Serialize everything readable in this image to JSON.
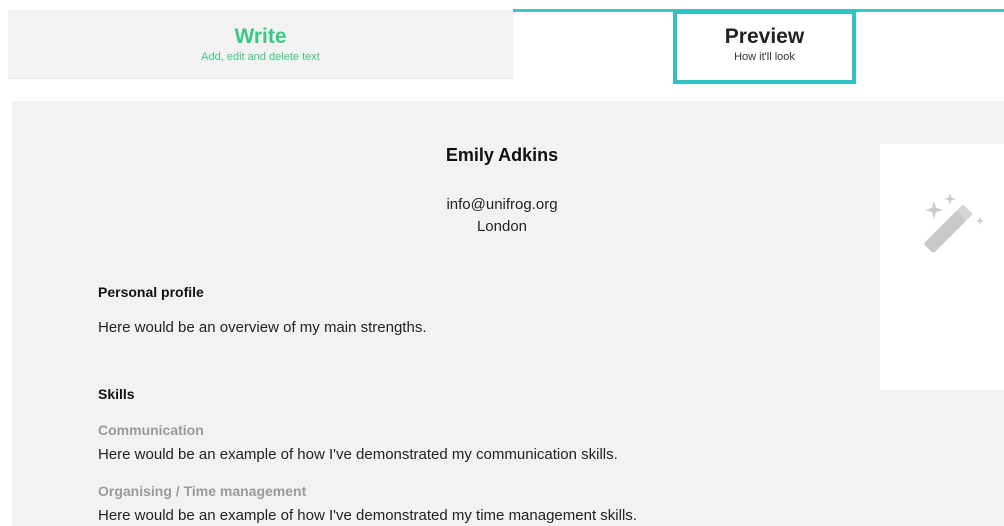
{
  "tabs": {
    "write": {
      "title": "Write",
      "subtitle": "Add, edit and delete text"
    },
    "preview": {
      "title": "Preview",
      "subtitle": "How it'll look"
    }
  },
  "cv": {
    "name": "Emily Adkins",
    "email": "info@unifrog.org",
    "city": "London",
    "profile": {
      "heading": "Personal profile",
      "text": "Here would be an overview of my main strengths."
    },
    "skills": {
      "heading": "Skills",
      "items": [
        {
          "title": "Communication",
          "text": "Here would be an example of how I've demonstrated my communication skills."
        },
        {
          "title": "Organising / Time management",
          "text": "Here would be an example of how I've demonstrated my time management skills."
        }
      ]
    }
  },
  "side_panel": {
    "icon": "magic-wand-icon"
  },
  "colors": {
    "write_accent": "#3cc784",
    "preview_border": "#36bfc2",
    "doc_background": "#f2f2f2",
    "subheading_gray": "#9a9a9a"
  }
}
